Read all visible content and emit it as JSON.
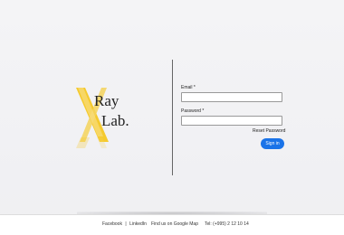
{
  "brand": {
    "logo_text_line1": "Ray",
    "logo_text_line2": "Lab.",
    "logo_letter": "X",
    "accent_color": "#f5c518",
    "text_color": "#222222"
  },
  "login": {
    "email_label": "Email *",
    "email_value": "",
    "password_label": "Password *",
    "password_value": "",
    "reset_link": "Reset Password",
    "signin_button": "Sign in",
    "button_color": "#1a73e8"
  },
  "footer": {
    "facebook": "Facebook",
    "separator": "|",
    "linkedin": "LinkedIn",
    "map_link": "Find us on Google Map",
    "phone": "Tel: (+995) 2 12 10 14"
  }
}
